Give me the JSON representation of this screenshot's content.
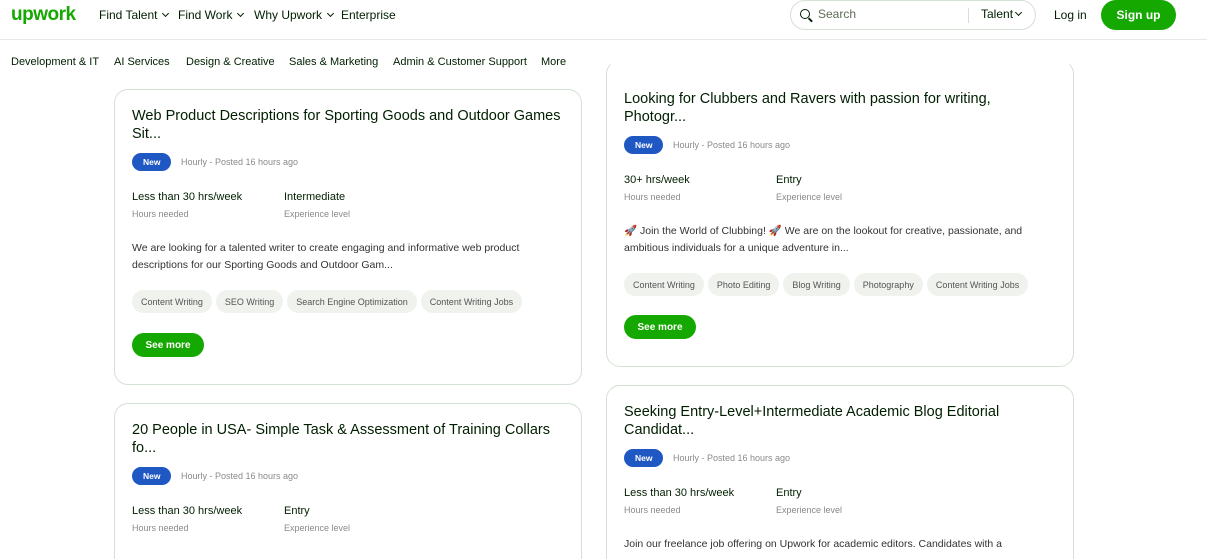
{
  "header": {
    "logo": "upwork",
    "nav": [
      {
        "label": "Find Talent",
        "has_chevron": true
      },
      {
        "label": "Find Work",
        "has_chevron": true
      },
      {
        "label": "Why Upwork",
        "has_chevron": true
      },
      {
        "label": "Enterprise",
        "has_chevron": false
      }
    ],
    "search": {
      "placeholder": "Search",
      "scope": "Talent"
    },
    "login": "Log in",
    "signup": "Sign up"
  },
  "categories": [
    "Development & IT",
    "AI Services",
    "Design & Creative",
    "Sales & Marketing",
    "Admin & Customer Support",
    "More"
  ],
  "jobs": [
    {
      "title": "Web Product Descriptions for Sporting Goods and Outdoor Games Sit...",
      "badge": "New",
      "posted": "Hourly - Posted 16 hours ago",
      "hours_value": "Less than 30 hrs/week",
      "hours_label": "Hours needed",
      "level_value": "Intermediate",
      "level_label": "Experience level",
      "description": "We are looking for a talented writer to create engaging and informative web product descriptions for our Sporting Goods and Outdoor Gam...",
      "tags": [
        "Content Writing",
        "SEO Writing",
        "Search Engine Optimization",
        "Content Writing Jobs"
      ],
      "see_more": "See more"
    },
    {
      "title": "Looking for Clubbers and Ravers with passion for writing, Photogr...",
      "badge": "New",
      "posted": "Hourly - Posted 16 hours ago",
      "hours_value": "30+ hrs/week",
      "hours_label": "Hours needed",
      "level_value": "Entry",
      "level_label": "Experience level",
      "description": "🚀 Join the World of Clubbing! 🚀 We are on the lookout for creative, passionate, and ambitious individuals for a unique adventure in...",
      "tags": [
        "Content Writing",
        "Photo Editing",
        "Blog Writing",
        "Photography",
        "Content Writing Jobs"
      ],
      "see_more": "See more"
    },
    {
      "title": "20 People in USA- Simple Task & Assessment of Training Collars fo...",
      "badge": "New",
      "posted": "Hourly - Posted 16 hours ago",
      "hours_value": "Less than 30 hrs/week",
      "hours_label": "Hours needed",
      "level_value": "Entry",
      "level_label": "Experience level"
    },
    {
      "title": "Seeking Entry-Level+Intermediate Academic Blog Editorial Candidat...",
      "badge": "New",
      "posted": "Hourly - Posted 16 hours ago",
      "hours_value": "Less than 30 hrs/week",
      "hours_label": "Hours needed",
      "level_value": "Entry",
      "level_label": "Experience level",
      "description": "Join our freelance job offering on Upwork for academic editors. Candidates with a"
    }
  ]
}
